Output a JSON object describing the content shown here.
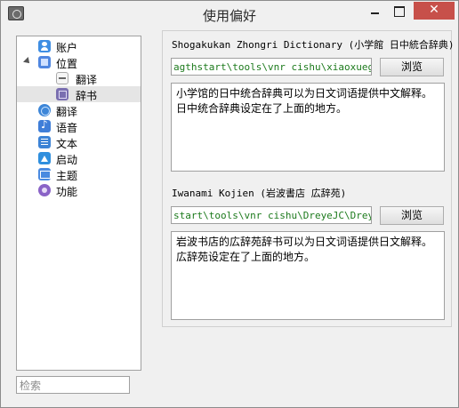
{
  "window": {
    "title": "使用偏好",
    "close_glyph": "✕"
  },
  "sidebar": {
    "items": [
      {
        "label": "账户",
        "icon": "user-icon"
      },
      {
        "label": "位置",
        "icon": "location-icon",
        "expanded": true
      },
      {
        "label": "翻译",
        "icon": "translate-sub-icon",
        "child": true
      },
      {
        "label": "辞书",
        "icon": "dictionary-icon",
        "child": true,
        "selected": true
      },
      {
        "label": "翻译",
        "icon": "globe-icon"
      },
      {
        "label": "语音",
        "icon": "music-icon"
      },
      {
        "label": "文本",
        "icon": "text-icon"
      },
      {
        "label": "启动",
        "icon": "launch-icon"
      },
      {
        "label": "主题",
        "icon": "theme-icon"
      },
      {
        "label": "功能",
        "icon": "feature-icon"
      }
    ],
    "search_placeholder": "检索"
  },
  "dictionaries": [
    {
      "title": "Shogakukan Zhongri Dictionary (小学館 日中統合辞典)",
      "path": "agthstart\\tools\\vnr cishu\\xiaoxueguan",
      "browse_label": "浏览",
      "description_line1": "小学馆的日中统合辞典可以为日文词语提供中文解释。",
      "description_line2": "日中统合辞典设定在了上面的地方。"
    },
    {
      "title": "Iwanami Kojien (岩波書店 広辞苑)",
      "path": "start\\tools\\vnr cishu\\DreyeJC\\DreyeJC",
      "browse_label": "浏览",
      "description_line1": "岩波书店的広辞苑辞书可以为日文词语提供日文解释。",
      "description_line2": "広辞苑设定在了上面的地方。"
    }
  ]
}
